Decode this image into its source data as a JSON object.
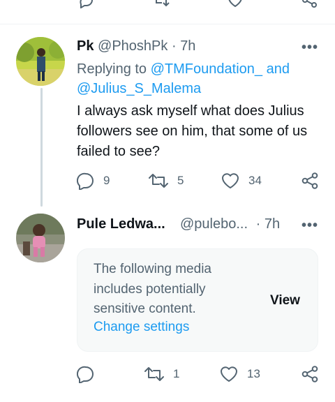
{
  "tweet1": {
    "display_name": "Pk",
    "handle": "@PhoshPk",
    "separator": "·",
    "time": "7h",
    "more_label": "•••",
    "replying_prefix": "Replying to",
    "replying_user1": "@TMFoundation_",
    "replying_and": "and",
    "replying_user2": "@Julius_S_Malema",
    "text": "I always ask myself what does Julius followers see on him, that some of us failed to see?",
    "replies": "9",
    "retweets": "5",
    "likes": "34"
  },
  "tweet2": {
    "display_name": "Pule Ledwa...",
    "handle": "@pulebo...",
    "separator": "·",
    "time": "7h",
    "more_label": "•••",
    "media_warning": "The following media includes potentially sensitive content.",
    "change_settings": "Change settings",
    "view_label": "View",
    "replies": "",
    "retweets": "1",
    "likes": "13"
  },
  "colors": {
    "accent": "#1d9bf0",
    "muted": "#536471",
    "text": "#0f1419"
  },
  "icons": [
    "reply-icon",
    "retweet-icon",
    "like-icon",
    "share-icon"
  ]
}
